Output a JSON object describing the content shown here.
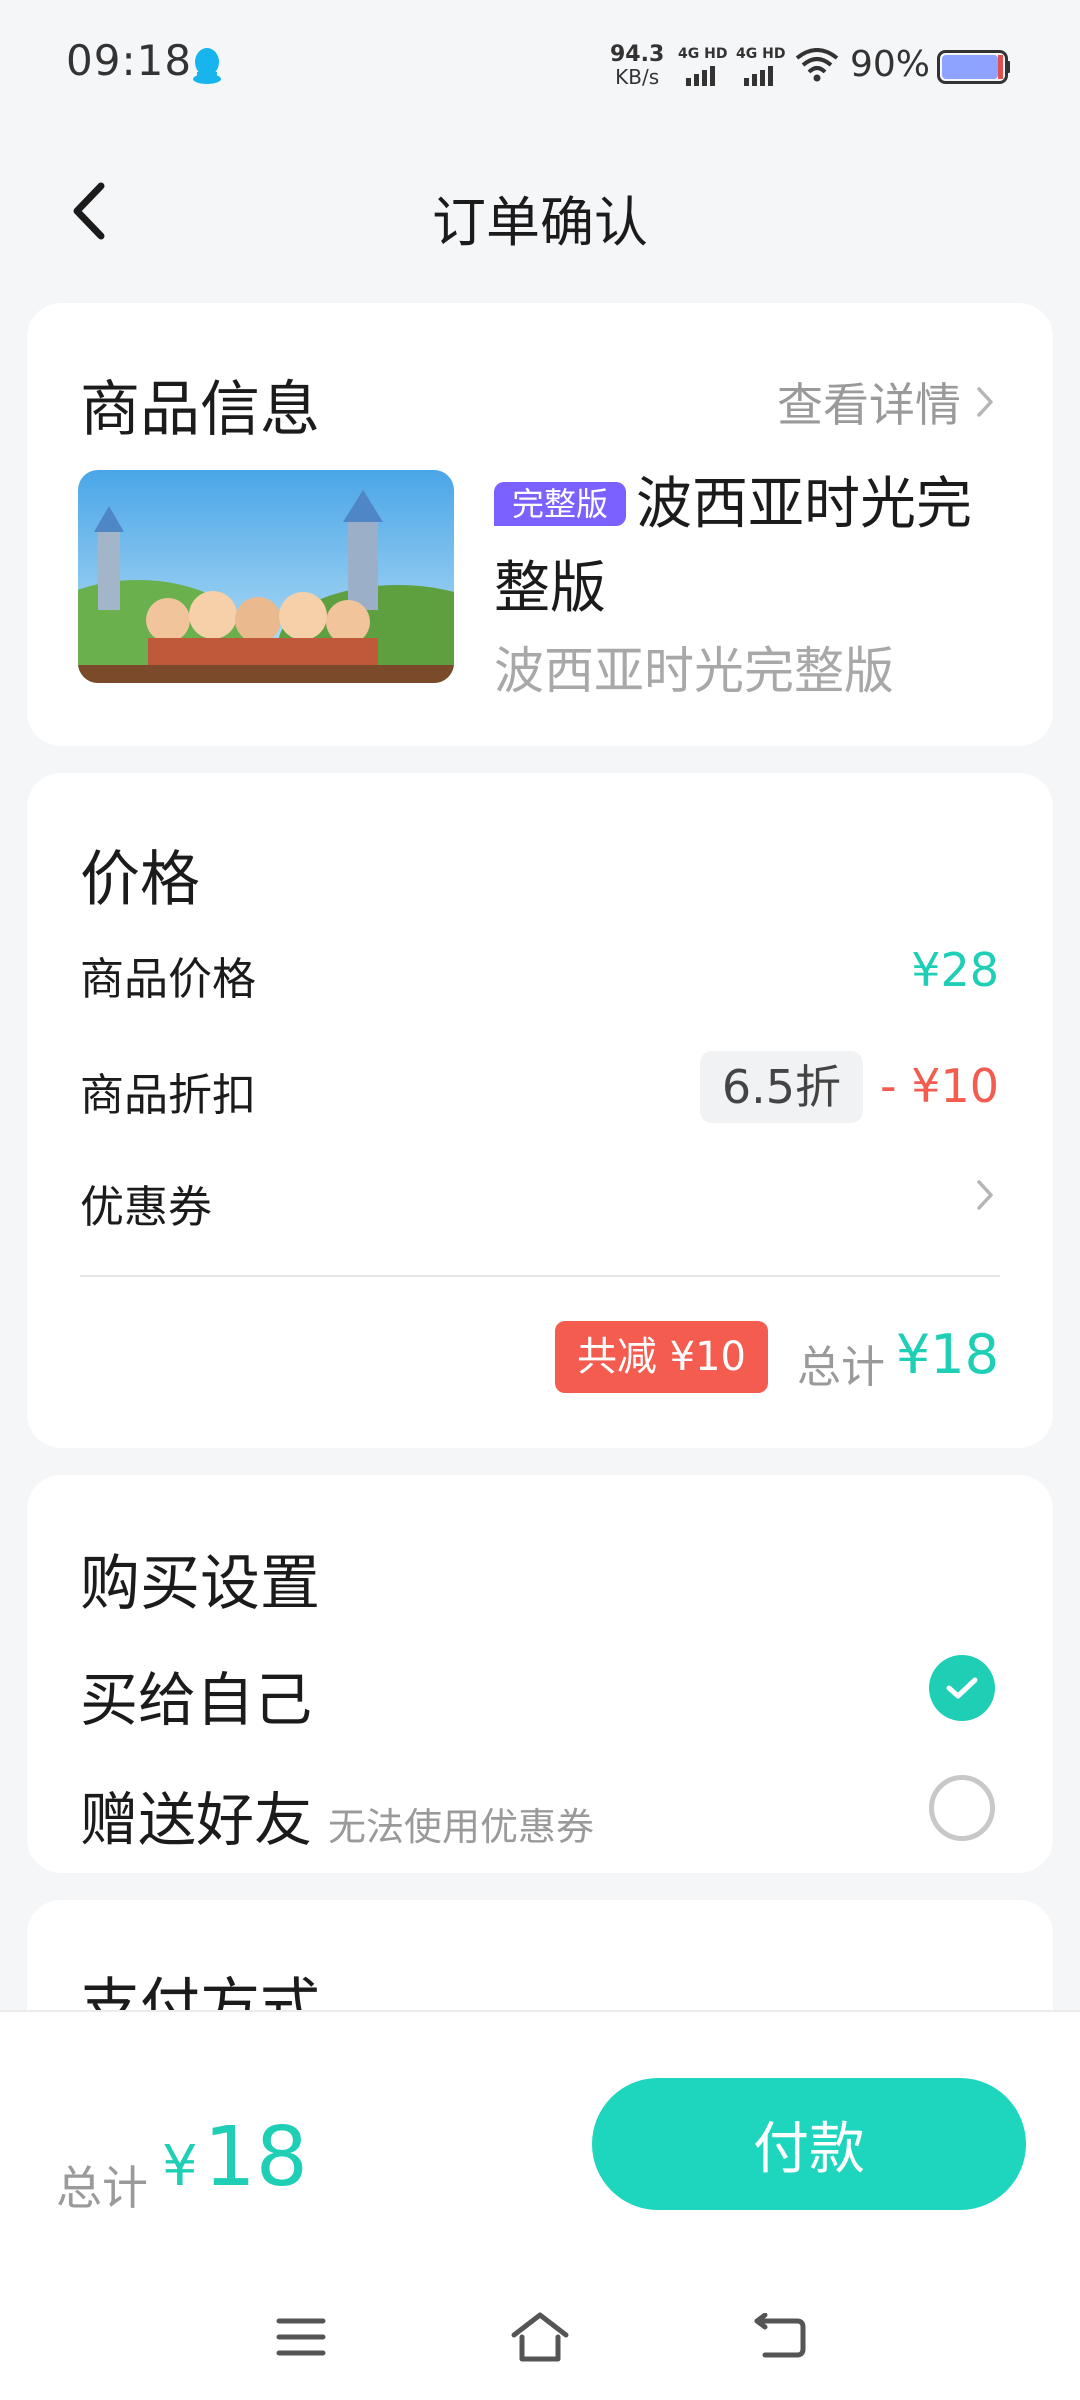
{
  "status_bar": {
    "time": "09:18",
    "net_speed_value": "94.3",
    "net_speed_unit": "KB/s",
    "signal1_label": "4G HD",
    "signal2_label": "4G HD",
    "battery_percent": "90%"
  },
  "header": {
    "title": "订单确认",
    "back_icon": "chevron-left-icon"
  },
  "product": {
    "section_title": "商品信息",
    "detail_link": "查看详情",
    "thumb_title": "波西亚时光",
    "thumb_badge": "完整版",
    "edition_badge": "完整版",
    "name": "波西亚时光完整版",
    "subtitle": "波西亚时光完整版"
  },
  "price": {
    "section_title": "价格",
    "item_price_label": "商品价格",
    "item_price_value": "¥28",
    "discount_label": "商品折扣",
    "discount_rate": "6.5折",
    "discount_value": "- ¥10",
    "coupon_label": "优惠券",
    "saving_badge": "共减 ¥10",
    "total_label": "总计",
    "total_value": "¥18"
  },
  "purchase": {
    "section_title": "购买设置",
    "self_label": "买给自己",
    "gift_label": "赠送好友",
    "gift_note": "无法使用优惠券"
  },
  "payment": {
    "section_title": "支付方式"
  },
  "bottom_bar": {
    "total_label": "总计",
    "currency": "¥",
    "total_amount": "18",
    "pay_button": "付款"
  },
  "colors": {
    "accent": "#1ecfb6",
    "discount_red": "#f35c4f",
    "badge_purple": "#7b61ff"
  }
}
